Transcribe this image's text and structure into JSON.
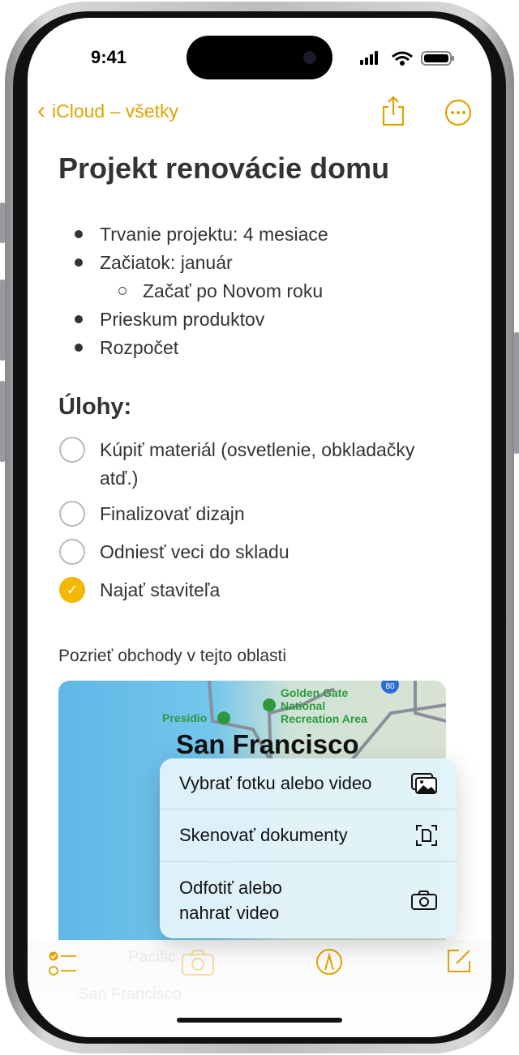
{
  "status": {
    "time": "9:41"
  },
  "nav": {
    "back_label": "iCloud – všetky"
  },
  "note": {
    "title": "Projekt renovácie domu",
    "bullets": [
      "Trvanie projektu: 4 mesiace",
      "Začiatok: január",
      "Začať po Novom roku",
      "Prieskum produktov",
      "Rozpočet"
    ],
    "tasks_heading": "Úlohy:",
    "tasks": [
      {
        "line1": "Kúpiť materiál (osvetlenie, obkladačky",
        "line2": "atď.)",
        "checked": false
      },
      {
        "line1": "Finalizovať dizajn",
        "checked": false
      },
      {
        "line1": "Odniesť veci do skladu",
        "checked": false
      },
      {
        "line1": "Najať staviteľa",
        "checked": true
      }
    ],
    "map_caption": "Pozrieť obchody v tejto oblasti",
    "map_labels": {
      "city": "San Francisco",
      "presidio": "Presidio",
      "ggnra1": "Golden Gate",
      "ggnra2": "National",
      "ggnra3": "Recreation Area",
      "route": "80",
      "pacific": "Pacific",
      "sf_small": "San Francisco"
    }
  },
  "menu": {
    "items": [
      {
        "label": "Vybrať fotku alebo video",
        "icon": "photo-library-icon"
      },
      {
        "label": "Skenovať dokumenty",
        "icon": "doc-scan-icon"
      },
      {
        "label1": "Odfotiť alebo",
        "label2": "nahrať video",
        "icon": "camera-icon"
      }
    ]
  },
  "colors": {
    "accent": "#E2A300",
    "checked": "#F5B800"
  }
}
